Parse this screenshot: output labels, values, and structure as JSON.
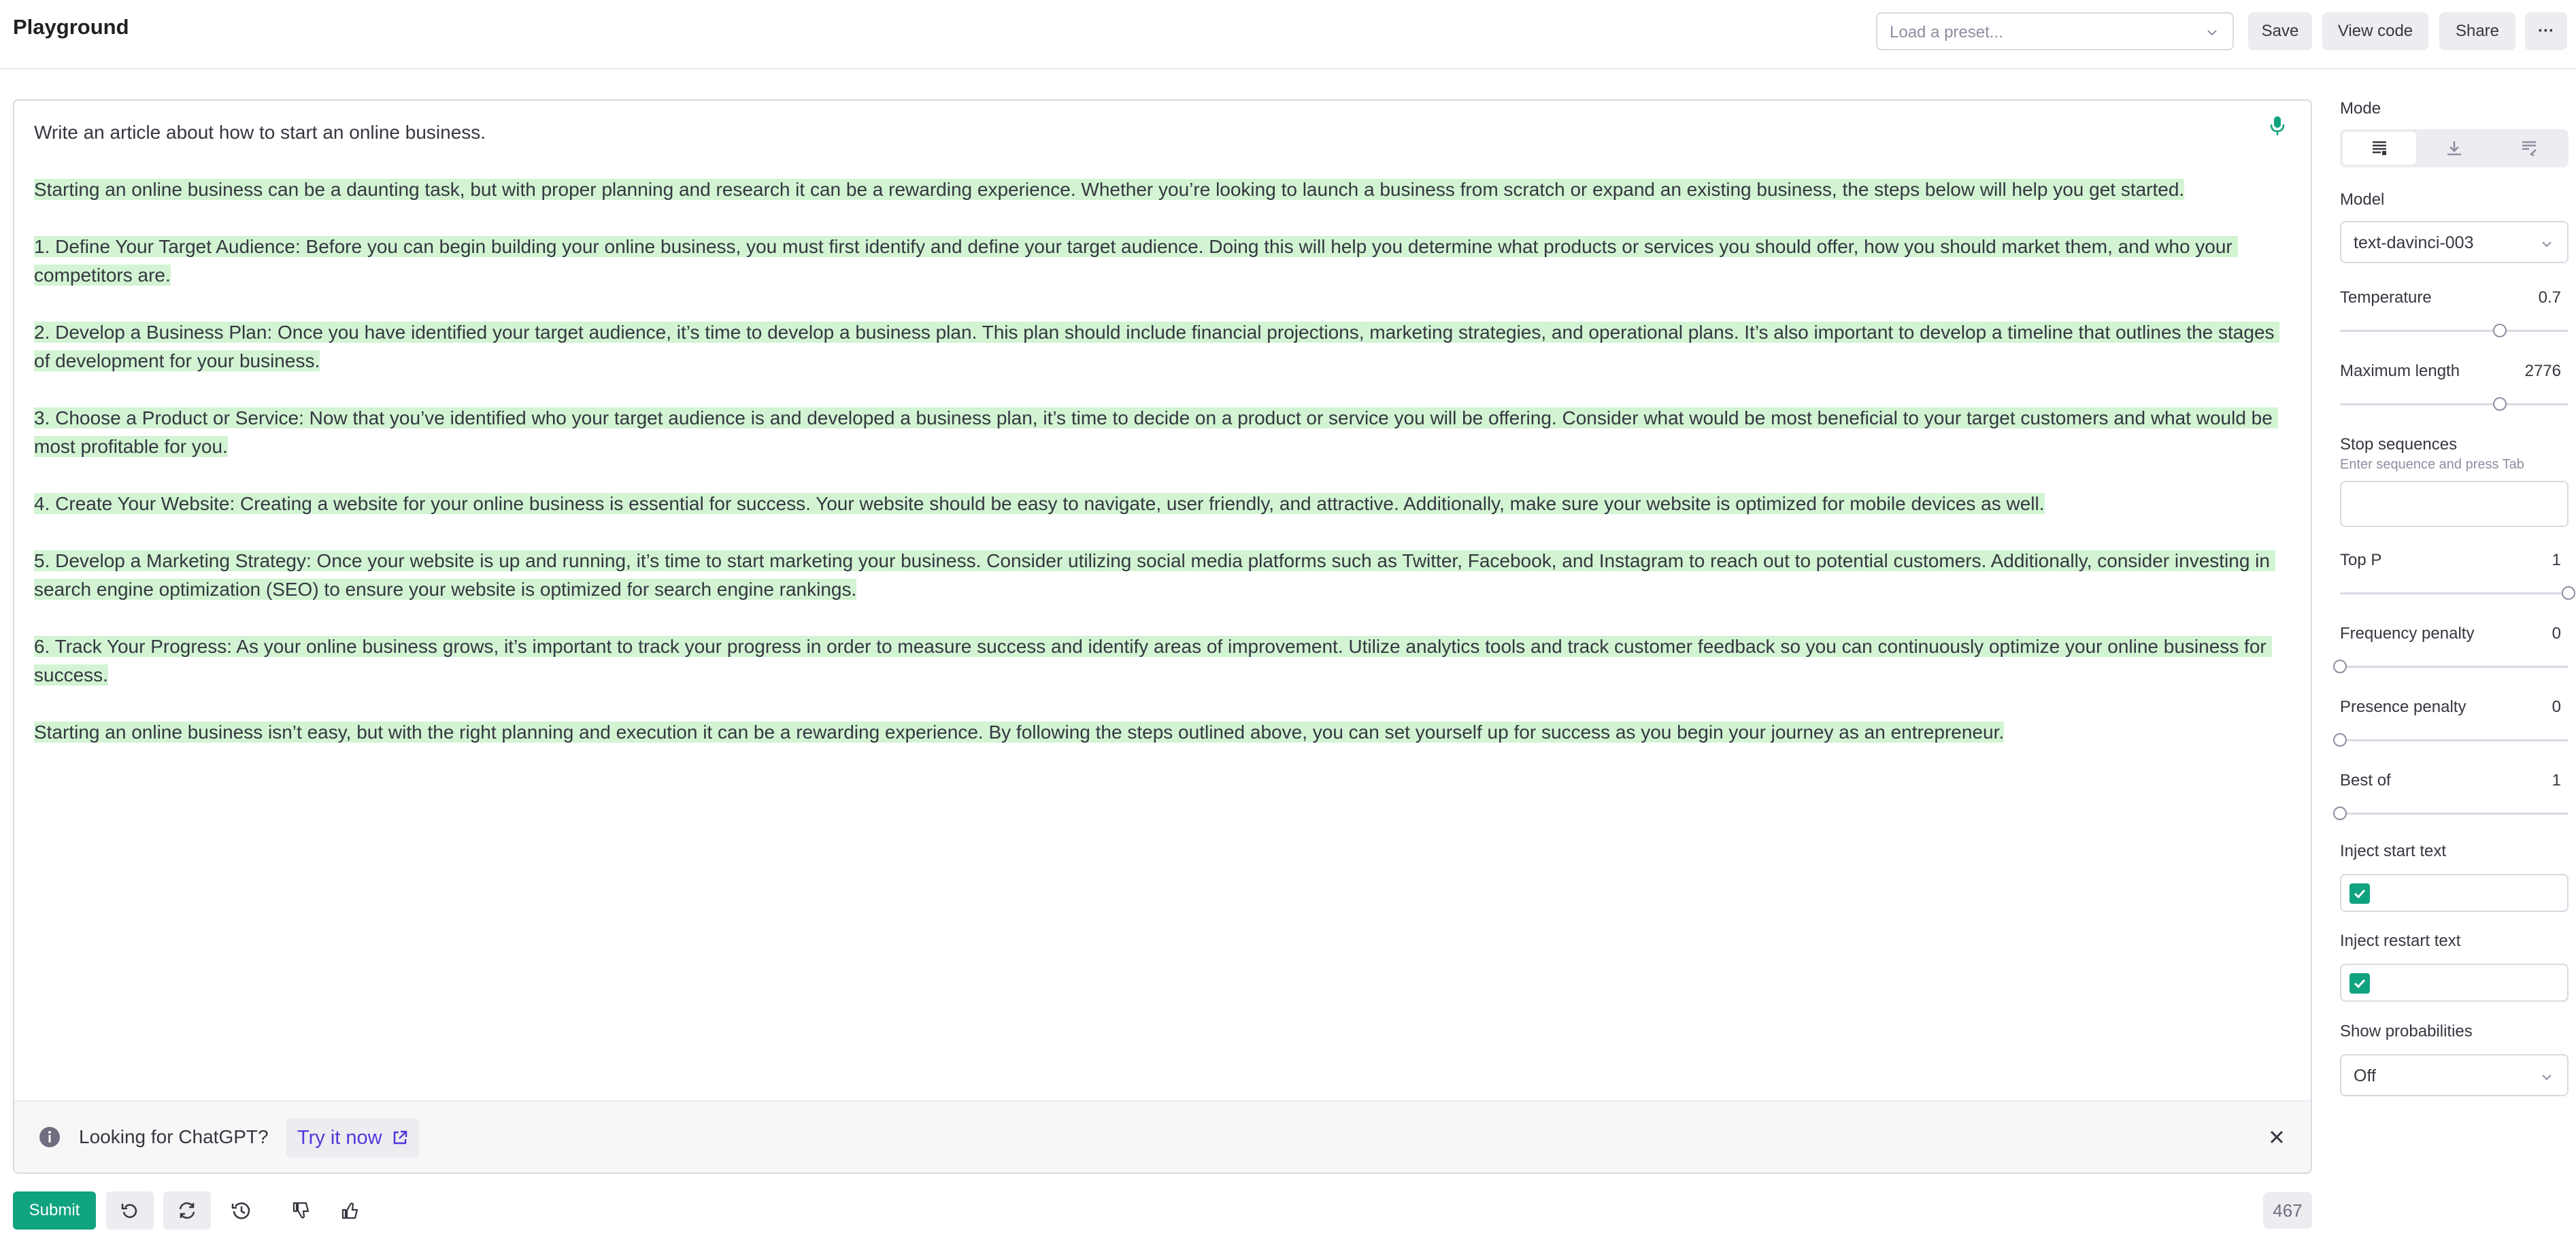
{
  "header": {
    "title": "Playground",
    "preset_placeholder": "Load a preset...",
    "save_label": "Save",
    "view_code_label": "View code",
    "share_label": "Share",
    "more_label": "···"
  },
  "editor": {
    "prompt": "Write an article about how to start an online business.",
    "completion": [
      "Starting an online business can be a daunting task, but with proper planning and research it can be a rewarding experience. Whether you’re looking to launch a business from scratch or expand an existing business, the steps below will help you get started.",
      "1. Define Your Target Audience: Before you can begin building your online business, you must first identify and define your target audience. Doing this will help you determine what products or services you should offer, how you should market them, and who your competitors are.",
      "2. Develop a Business Plan: Once you have identified your target audience, it’s time to develop a business plan. This plan should include financial projections, marketing strategies, and operational plans. It’s also important to develop a timeline that outlines the stages of development for your business.",
      "3. Choose a Product or Service: Now that you’ve identified who your target audience is and developed a business plan, it’s time to decide on a product or service you will be offering. Consider what would be most beneficial to your target customers and what would be most profitable for you.",
      "4. Create Your Website: Creating a website for your online business is essential for success. Your website should be easy to navigate, user friendly, and attractive. Additionally, make sure your website is optimized for mobile devices as well.",
      "5. Develop a Marketing Strategy: Once your website is up and running, it’s time to start marketing your business. Consider utilizing social media platforms such as Twitter, Facebook, and Instagram to reach out to potential customers. Additionally, consider investing in search engine optimization (SEO) to ensure your website is optimized for search engine rankings.",
      "6. Track Your Progress: As your online business grows, it’s important to track your progress in order to measure success and identify areas of improvement. Utilize analytics tools and track customer feedback so you can continuously optimize your online business for success.",
      "Starting an online business isn’t easy, but with the right planning and execution it can be a rewarding experience. By following the steps outlined above, you can set yourself up for success as you begin your journey as an entrepreneur."
    ]
  },
  "banner": {
    "text": "Looking for ChatGPT?",
    "link_label": "Try it now"
  },
  "footer": {
    "submit_label": "Submit",
    "token_count": "467"
  },
  "sidebar": {
    "mode_label": "Mode",
    "mode_icons": [
      "complete-icon",
      "insert-icon",
      "edit-icon"
    ],
    "model_label": "Model",
    "model_value": "text-davinci-003",
    "temperature": {
      "label": "Temperature",
      "value": "0.7",
      "level": 0.7
    },
    "max_length": {
      "label": "Maximum length",
      "value": "2776",
      "level": 0.7
    },
    "stop_sequences": {
      "label": "Stop sequences",
      "hint": "Enter sequence and press Tab"
    },
    "top_p": {
      "label": "Top P",
      "value": "1",
      "level": 1.0
    },
    "frequency_penalty": {
      "label": "Frequency penalty",
      "value": "0",
      "level": 0.0
    },
    "presence_penalty": {
      "label": "Presence penalty",
      "value": "0",
      "level": 0.0
    },
    "best_of": {
      "label": "Best of",
      "value": "1",
      "level": 0.0
    },
    "inject_start": {
      "label": "Inject start text",
      "checked": true
    },
    "inject_restart": {
      "label": "Inject restart text",
      "checked": true
    },
    "show_probabilities": {
      "label": "Show probabilities",
      "value": "Off"
    }
  },
  "colors": {
    "accent": "#10a37f",
    "completion_highlight": "#d2f4d3",
    "link": "#5436da"
  }
}
